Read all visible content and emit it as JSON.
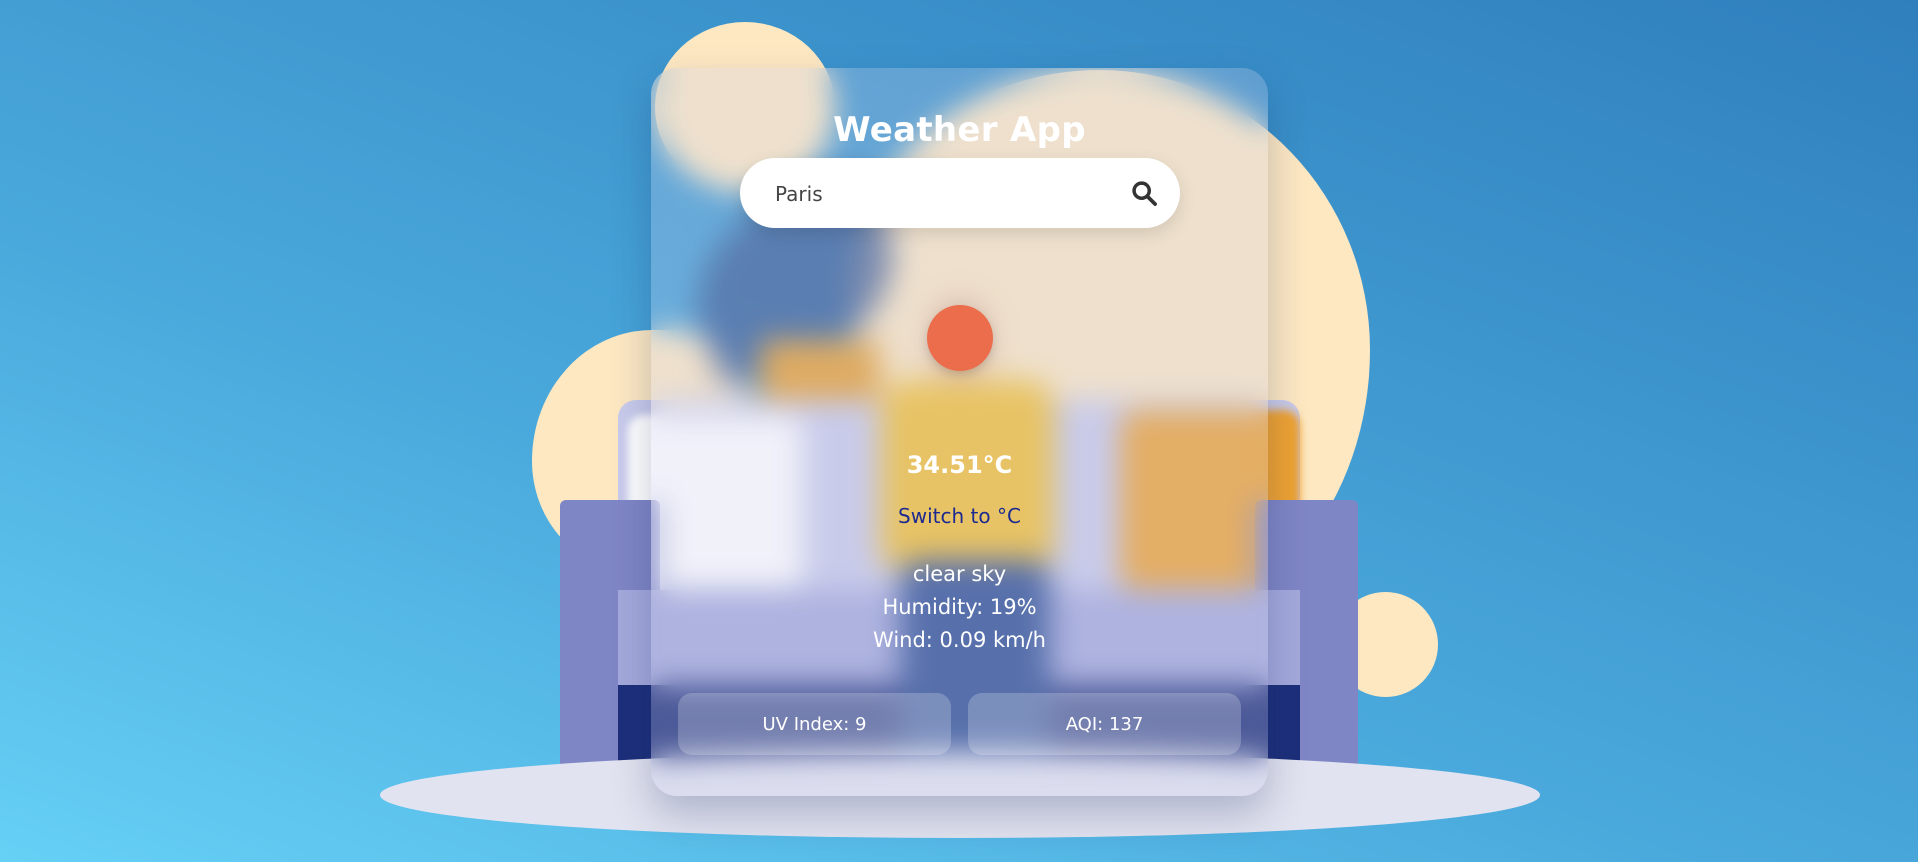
{
  "app": {
    "title": "Weather App"
  },
  "search": {
    "value": "Paris",
    "icon": "search-icon"
  },
  "weather": {
    "icon": "sun-icon",
    "temperature": "34.51°C",
    "switch_label": "Switch to °C",
    "description": "clear sky",
    "humidity": "Humidity: 19%",
    "wind": "Wind: 0.09 km/h"
  },
  "metrics": {
    "uv": "UV Index: 9",
    "aqi": "AQI: 137"
  },
  "colors": {
    "accent_sun": "#ec6d4b",
    "link": "#1c2a8f",
    "blob": "#fde8c2",
    "couch": "#7f86c6"
  }
}
